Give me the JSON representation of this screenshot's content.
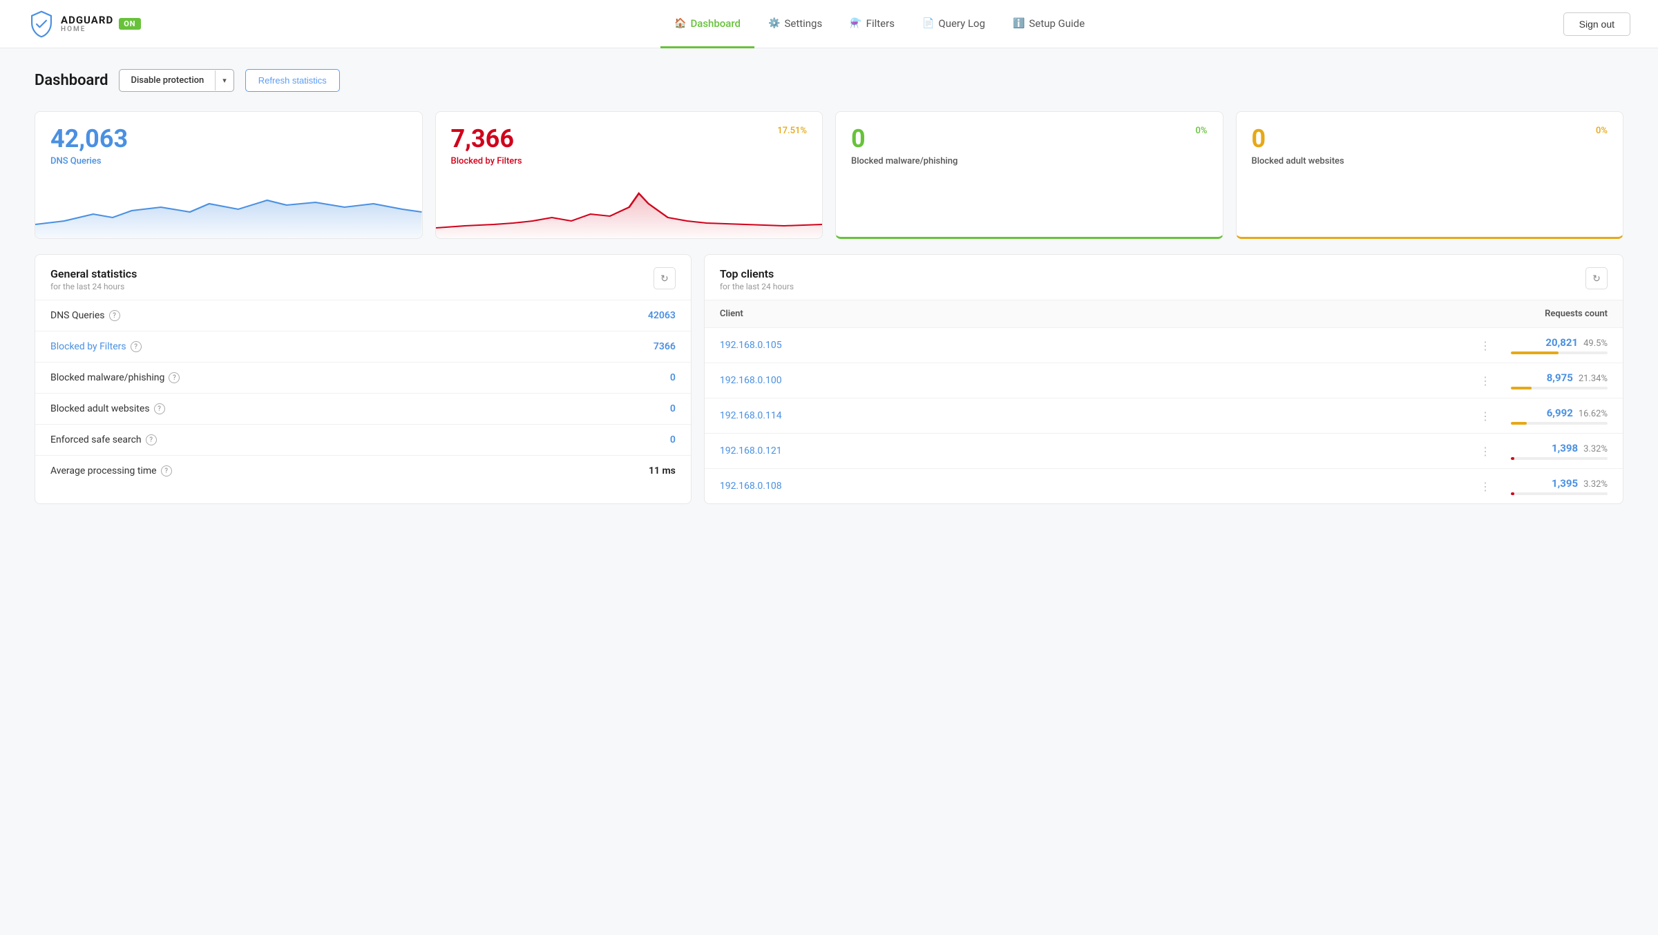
{
  "header": {
    "logo": {
      "adguard": "ADGUARD",
      "home": "HOME",
      "on_badge": "ON"
    },
    "nav": [
      {
        "id": "dashboard",
        "label": "Dashboard",
        "icon": "🏠",
        "active": true
      },
      {
        "id": "settings",
        "label": "Settings",
        "icon": "⚙️",
        "active": false
      },
      {
        "id": "filters",
        "label": "Filters",
        "icon": "⚗️",
        "active": false
      },
      {
        "id": "query-log",
        "label": "Query Log",
        "icon": "📄",
        "active": false
      },
      {
        "id": "setup-guide",
        "label": "Setup Guide",
        "icon": "ℹ️",
        "active": false
      }
    ],
    "sign_out": "Sign out"
  },
  "page": {
    "title": "Dashboard",
    "disable_protection_label": "Disable protection",
    "refresh_statistics_label": "Refresh statistics"
  },
  "stat_cards": [
    {
      "id": "dns-queries",
      "number": "42,063",
      "label": "DNS Queries",
      "color": "blue",
      "badge": null
    },
    {
      "id": "blocked-by-filters",
      "number": "7,366",
      "label": "Blocked by Filters",
      "color": "red",
      "badge": "17.51%",
      "badge_color": "orange"
    },
    {
      "id": "blocked-malware",
      "number": "0",
      "label": "Blocked malware/phishing",
      "color": "green",
      "badge": "0%",
      "badge_color": "green"
    },
    {
      "id": "blocked-adult",
      "number": "0",
      "label": "Blocked adult websites",
      "color": "orange",
      "badge": "0%",
      "badge_color": "orange"
    }
  ],
  "general_stats": {
    "title": "General statistics",
    "subtitle": "for the last 24 hours",
    "rows": [
      {
        "id": "dns-queries",
        "label": "DNS Queries",
        "value": "42063",
        "value_color": "blue",
        "is_link": false
      },
      {
        "id": "blocked-filters",
        "label": "Blocked by Filters",
        "value": "7366",
        "value_color": "blue",
        "is_link": true
      },
      {
        "id": "blocked-malware",
        "label": "Blocked malware/phishing",
        "value": "0",
        "value_color": "blue",
        "is_link": false
      },
      {
        "id": "blocked-adult",
        "label": "Blocked adult websites",
        "value": "0",
        "value_color": "blue",
        "is_link": false
      },
      {
        "id": "enforced-safe-search",
        "label": "Enforced safe search",
        "value": "0",
        "value_color": "blue",
        "is_link": false
      },
      {
        "id": "avg-processing",
        "label": "Average processing time",
        "value": "11 ms",
        "value_color": "dark",
        "is_link": false
      }
    ]
  },
  "top_clients": {
    "title": "Top clients",
    "subtitle": "for the last 24 hours",
    "col_client": "Client",
    "col_requests": "Requests count",
    "clients": [
      {
        "ip": "192.168.0.105",
        "count": "20,821",
        "pct": "49.5%",
        "bar_pct": 49.5,
        "bar_color": "yellow"
      },
      {
        "ip": "192.168.0.100",
        "count": "8,975",
        "pct": "21.34%",
        "bar_pct": 21.34,
        "bar_color": "yellow"
      },
      {
        "ip": "192.168.0.114",
        "count": "6,992",
        "pct": "16.62%",
        "bar_pct": 16.62,
        "bar_color": "yellow"
      },
      {
        "ip": "192.168.0.121",
        "count": "1,398",
        "pct": "3.32%",
        "bar_pct": 3.32,
        "bar_color": "red"
      },
      {
        "ip": "192.168.0.108",
        "count": "1,395",
        "pct": "3.32%",
        "bar_pct": 3.32,
        "bar_color": "red"
      }
    ]
  },
  "icons": {
    "refresh": "↻",
    "chevron_down": "▾",
    "help": "?",
    "menu_dots": "⋮"
  }
}
